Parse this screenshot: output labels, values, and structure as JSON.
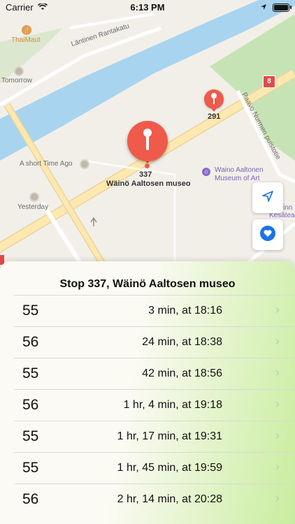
{
  "status_bar": {
    "carrier": "Carrier",
    "time": "6:13 PM",
    "battery_level": 0.9
  },
  "map": {
    "street_name": "Läntinen Rantakatu",
    "street_name_2": "Paavo Nurmen puistotie",
    "poi_thai": "ThaiMaut",
    "poi_tomorrow": "Tomorrow",
    "poi_short_time": "A short Time Ago",
    "poi_yesterday": "Yesterday",
    "museum_line1": "Waino Aaltonen",
    "museum_line2": "Museum of Art",
    "partial_label_1": "inn",
    "partial_label_2": "Kesäteatte",
    "route_badge": "8",
    "stop_big_number": "337",
    "stop_big_name": "Wäinö Aaltosen museo",
    "stop_small_number": "291",
    "colors": {
      "land": "#f2efe9",
      "water": "#a8d4ef",
      "park": "#c6e3b5",
      "road": "#fde8b0",
      "pin": "#ef5a4b"
    }
  },
  "controls": {
    "location_icon": "location-arrow-icon",
    "favorite_icon": "heart-icon"
  },
  "panel": {
    "title": "Stop 337, Wäinö Aaltosen museo",
    "departures": [
      {
        "route": "55",
        "time": "3 min, at 18:16"
      },
      {
        "route": "56",
        "time": "24 min, at 18:38"
      },
      {
        "route": "55",
        "time": "42 min, at 18:56"
      },
      {
        "route": "56",
        "time": "1 hr, 4 min, at 19:18"
      },
      {
        "route": "55",
        "time": "1 hr, 17 min, at 19:31"
      },
      {
        "route": "55",
        "time": "1 hr, 45 min, at 19:59"
      },
      {
        "route": "56",
        "time": "2 hr, 14 min, at 20:28"
      }
    ]
  }
}
